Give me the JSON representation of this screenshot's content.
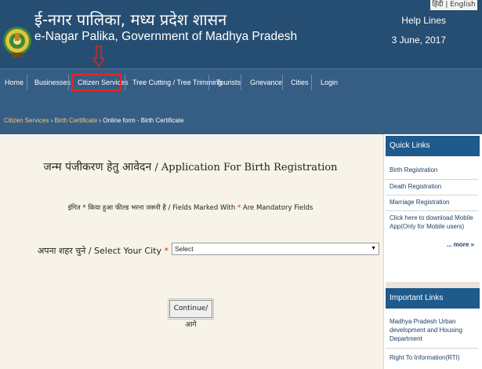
{
  "header": {
    "title_hindi": "ई-नगर पालिका, मध्य प्रदेश शासन",
    "title_english": "e-Nagar Palika, Government of Madhya Pradesh",
    "language_switch": "हिंदी | English",
    "help_lines": "Help Lines",
    "date": "3 June, 2017"
  },
  "nav": {
    "items": [
      "Home",
      "Businesses",
      "Citizen Services",
      "Tree Cutting / Tree Trimming",
      "Tourists",
      "Grievance",
      "Cities",
      "Login"
    ]
  },
  "breadcrumb": {
    "crumbs": [
      "Citizen Services",
      "Birth Certificate",
      "Online form - Birth Certificate"
    ],
    "separator": "›"
  },
  "form": {
    "title_hindi": "जन्म पंजीकरण हेतु आवेदन",
    "title_english": "/ Application For Birth Registration",
    "mandatory_text_pre": "इंगित * किया हुआ फील्ड भरना जरूरी है / Fields Marked With ",
    "mandatory_star": "*",
    "mandatory_text_post": " Are Mandatory Fields",
    "city_label": "अपना शहर चुने / Select Your City",
    "city_required": "*",
    "city_select_value": "Select",
    "continue_label": "Continue/आगे"
  },
  "sidebar": {
    "quick_links_title": "Quick Links",
    "quick_links": [
      "Birth Registration",
      "Death Registration",
      "Marriage Registration",
      "Click here to download Mobile App(Only for Mobile users)"
    ],
    "more_label": "... more »",
    "important_links_title": "Important Links",
    "important_links": [
      "Madhya Pradesh Urban development and Housing Department",
      "Right To Information(RTI)"
    ]
  },
  "colors": {
    "header_bg": "#264e72",
    "nav_bg": "#365e85",
    "page_bg": "#f7f3e8",
    "sidebar_header": "#1e5a8b",
    "highlight": "#e32727",
    "breadcrumb_link": "#f0c878"
  },
  "icons": {
    "emblem": "mp-state-emblem",
    "annotation": "down-arrow-annotation",
    "select_caret": "caret-down-icon"
  }
}
